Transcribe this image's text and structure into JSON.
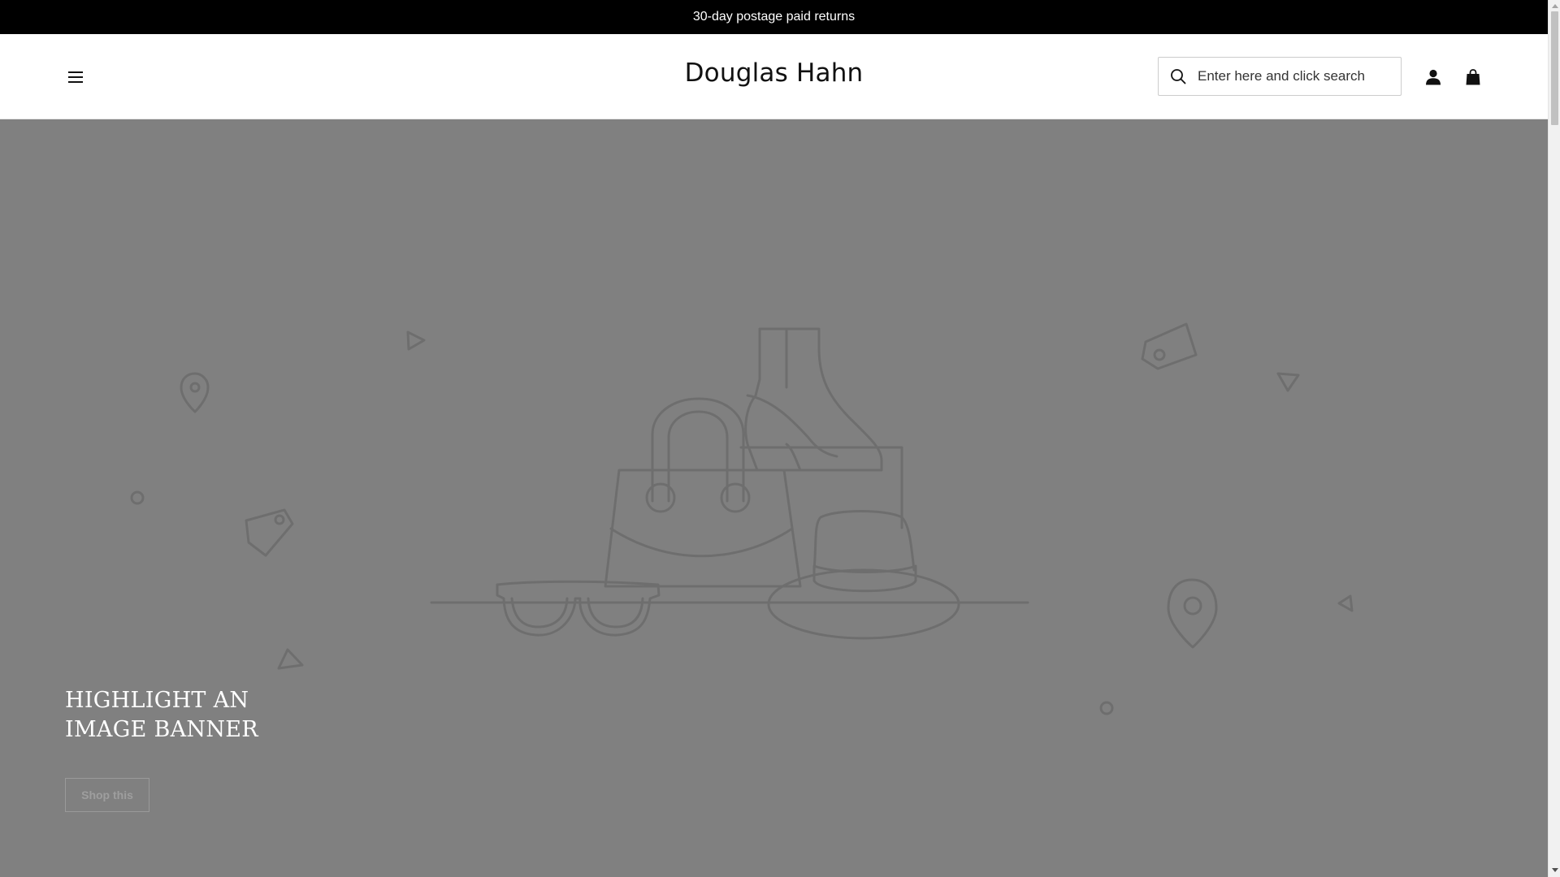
{
  "announcement": {
    "text": "30-day postage paid returns"
  },
  "header": {
    "logo": "Douglas Hahn",
    "search": {
      "placeholder": "Enter here and click search",
      "value": ""
    },
    "icons": {
      "menu": "hamburger-menu-icon",
      "search": "search-icon",
      "account": "user-icon",
      "cart": "shopping-bag-icon"
    }
  },
  "hero": {
    "heading_line1": "HIGHLIGHT AN",
    "heading_line2": "IMAGE BANNER",
    "cta_label": "Shop this"
  },
  "colors": {
    "announcement_bg": "#000000",
    "hero_bg": "#808080",
    "illustration_stroke": "#6e6e6e",
    "text_dark": "#111111",
    "text_light": "#ffffff"
  }
}
